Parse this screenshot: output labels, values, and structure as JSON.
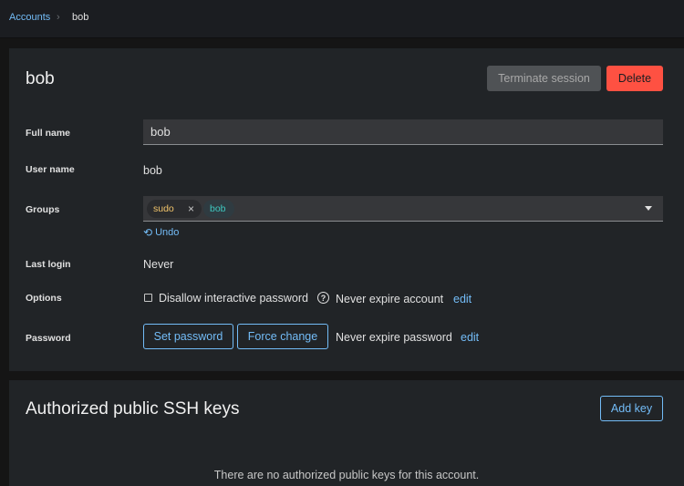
{
  "breadcrumb": {
    "parent": "Accounts",
    "separator": "›",
    "current": "bob"
  },
  "account": {
    "title": "bob",
    "terminate_label": "Terminate session",
    "delete_label": "Delete"
  },
  "fields": {
    "full_name_label": "Full name",
    "full_name_value": "bob",
    "user_name_label": "User name",
    "user_name_value": "bob",
    "groups_label": "Groups",
    "groups": [
      {
        "name": "sudo",
        "remove": "×"
      },
      {
        "name": "bob"
      }
    ],
    "undo_label": "Undo",
    "last_login_label": "Last login",
    "last_login_value": "Never",
    "options_label": "Options",
    "disallow_password_label": "Disallow interactive password",
    "disallow_password_checked": false,
    "never_expire_account_label": "Never expire account",
    "never_expire_account_edit": "edit",
    "password_label": "Password",
    "set_password_label": "Set password",
    "force_change_label": "Force change",
    "never_expire_password_label": "Never expire password",
    "never_expire_password_edit": "edit"
  },
  "ssh_keys": {
    "title": "Authorized public SSH keys",
    "add_key_label": "Add key",
    "empty_text": "There are no authorized public keys for this account."
  },
  "colors": {
    "accent": "#73bcf7",
    "danger": "#fe5142",
    "background": "#151515",
    "card": "#212427"
  }
}
